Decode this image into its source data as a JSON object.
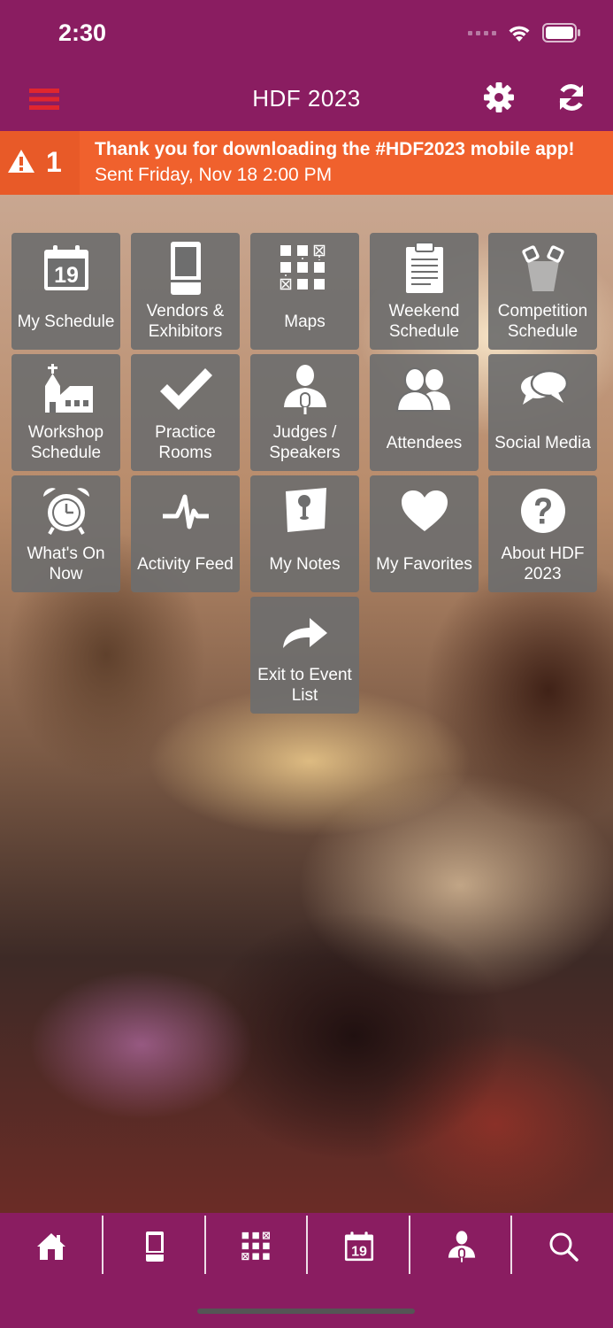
{
  "status_bar": {
    "time": "2:30"
  },
  "nav": {
    "title": "HDF 2023",
    "menu_icon": "hamburger-icon",
    "settings_icon": "gear-icon",
    "refresh_icon": "refresh-icon"
  },
  "alert": {
    "count": "1",
    "title": "Thank you for downloading the #HDF2023 mobile app!",
    "subtitle": "Sent Friday, Nov 18 2:00 PM",
    "color": "#f0612d"
  },
  "colors": {
    "brand": "#8a1d61",
    "tile": "#6e6e6e",
    "menu_icon": "#e0262e"
  },
  "tiles": [
    {
      "label": "My Schedule",
      "icon": "calendar-icon",
      "calendar_day": "19"
    },
    {
      "label": "Vendors &\nExhibitors",
      "icon": "booth-icon"
    },
    {
      "label": "Maps",
      "icon": "floorplan-icon"
    },
    {
      "label": "Weekend\nSchedule",
      "icon": "clipboard-icon"
    },
    {
      "label": "Competition\nSchedule",
      "icon": "spotlight-icon"
    },
    {
      "label": "Workshop\nSchedule",
      "icon": "church-icon"
    },
    {
      "label": "Practice\nRooms",
      "icon": "checkmark-icon"
    },
    {
      "label": "Judges /\nSpeakers",
      "icon": "speaker-icon"
    },
    {
      "label": "Attendees",
      "icon": "people-icon"
    },
    {
      "label": "Social Media",
      "icon": "chat-bubbles-icon"
    },
    {
      "label": "What's On\nNow",
      "icon": "alarm-clock-icon"
    },
    {
      "label": "Activity Feed",
      "icon": "pulse-icon"
    },
    {
      "label": "My Notes",
      "icon": "note-pin-icon"
    },
    {
      "label": "My Favorites",
      "icon": "heart-icon"
    },
    {
      "label": "About HDF\n2023",
      "icon": "question-icon"
    },
    {
      "label": "Exit to Event\nList",
      "icon": "share-arrow-icon"
    }
  ],
  "tab_bar": [
    {
      "name": "home",
      "icon": "home-icon"
    },
    {
      "name": "vendors",
      "icon": "booth-icon"
    },
    {
      "name": "maps",
      "icon": "floorplan-icon"
    },
    {
      "name": "schedule",
      "icon": "calendar-icon",
      "calendar_day": "19"
    },
    {
      "name": "speakers",
      "icon": "speaker-icon"
    },
    {
      "name": "search",
      "icon": "search-icon"
    }
  ]
}
